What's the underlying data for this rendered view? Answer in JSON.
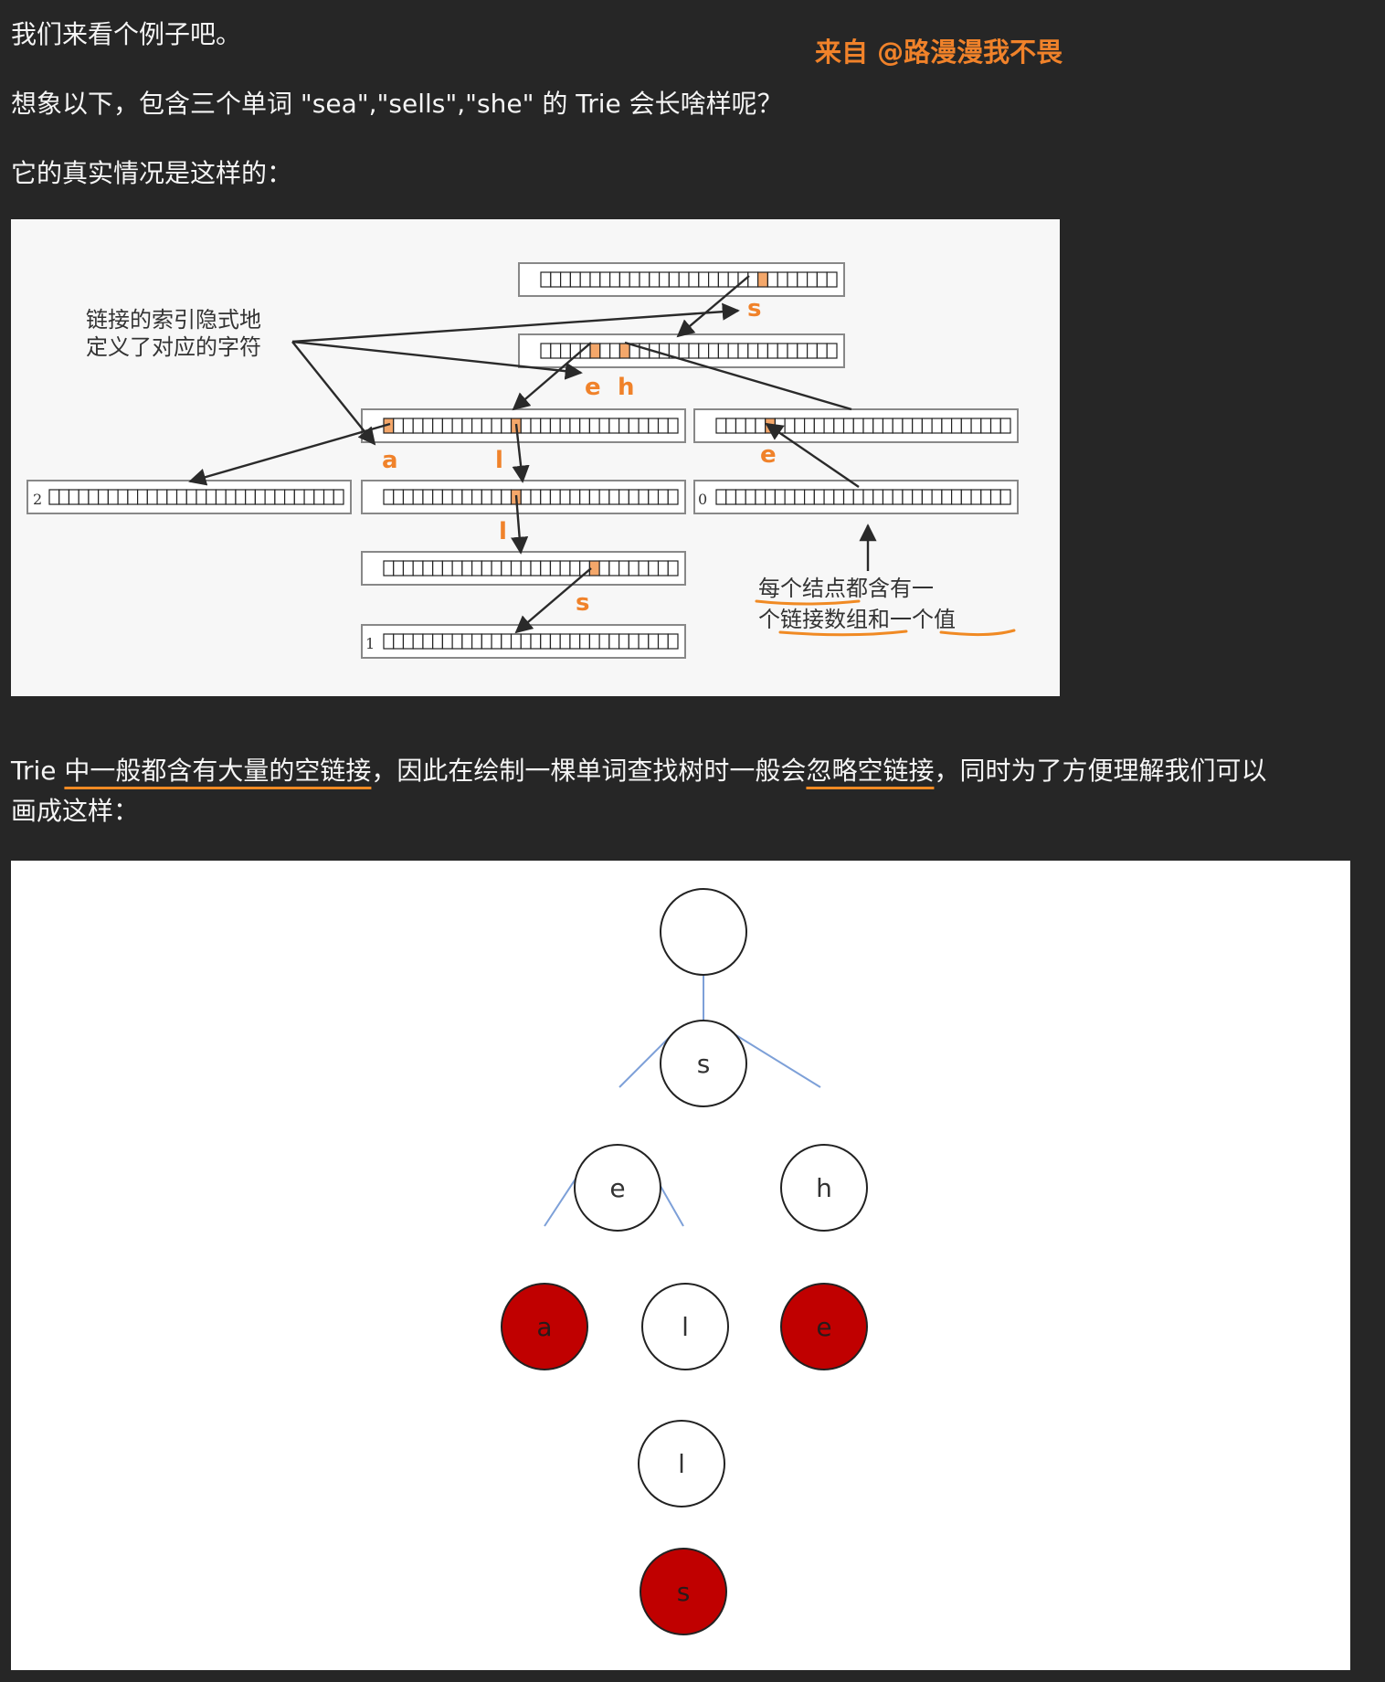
{
  "credit": "来自 @路漫漫我不畏",
  "paragraphs": {
    "p1": "我们来看个例子吧。",
    "p2": "想象以下，包含三个单词 \"sea\",\"sells\",\"she\" 的 Trie 会长啥样呢？",
    "p3": "它的真实情况是这样的：",
    "p4_a": "Trie ",
    "p4_b": "中一般都含有大量的空链接",
    "p4_c": "，因此在绘制一棵单词查找树时一般会",
    "p4_d": "忽略空链接",
    "p4_e": "，同时为了方便理解我们可以",
    "p5": "画成这样："
  },
  "figure1": {
    "annotation_left_line1": "链接的索引隐式地",
    "annotation_left_line2": "定义了对应的字符",
    "annotation_right_line1": "每个结点都含有一",
    "annotation_right_line2": "个链接数组和一个值",
    "letters": {
      "s_top": "s",
      "e": "e",
      "h": "h",
      "a": "a",
      "l1": "l",
      "e2": "e",
      "l2": "l",
      "s_bottom": "s"
    },
    "values": {
      "v2": "2",
      "v0": "0",
      "v1": "1"
    },
    "accent_color": "#f0822a",
    "highlight_color": "#f4a76a"
  },
  "figure2": {
    "nodes": {
      "root": "",
      "s": "s",
      "e": "e",
      "h": "h",
      "a": "a",
      "l1": "l",
      "e2": "e",
      "l2": "l",
      "s2": "s"
    },
    "terminal_color": "#c00000",
    "edge_color": "#7da0d8"
  }
}
